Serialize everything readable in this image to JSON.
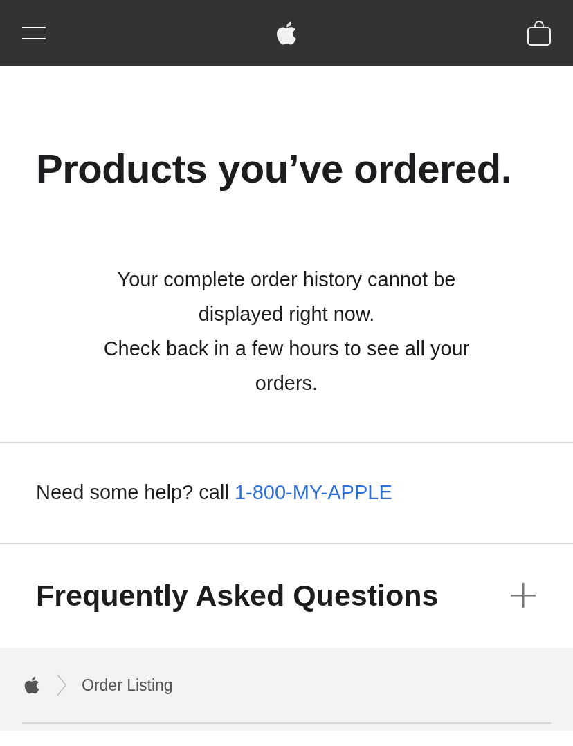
{
  "title": "Products you’ve ordered.",
  "notice": [
    "Your complete order history cannot be displayed right now.",
    "Check back in a few hours to see all your orders."
  ],
  "help": {
    "text": "Need some help? call",
    "link": "1-800-MY-APPLE"
  },
  "faq": {
    "heading": "Frequently Asked Questions",
    "expanded": false
  },
  "breadcrumb": {
    "items": [
      "Order Listing"
    ]
  }
}
